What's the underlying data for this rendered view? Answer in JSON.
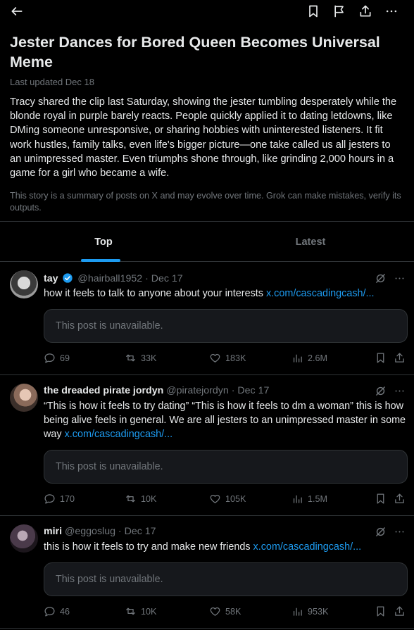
{
  "story": {
    "headline": "Jester Dances for Bored Queen Becomes Universal Meme",
    "updated": "Last updated Dec 18",
    "summary": "Tracy shared the clip last Saturday, showing the jester tumbling desperately while the blonde royal in purple barely reacts. People quickly applied it to dating letdowns, like DMing someone unresponsive, or sharing hobbies with uninterested listeners. It fit work hustles, family talks, even life's bigger picture—one take called us all jesters to an unimpressed master. Even triumphs shone through, like grinding 2,000 hours in a game for a girl who became a wife.",
    "disclaimer": "This story is a summary of posts on X and may evolve over time. Grok can make mistakes, verify its outputs."
  },
  "tabs": {
    "top": "Top",
    "latest": "Latest"
  },
  "unavailable_text": "This post is unavailable.",
  "posts": [
    {
      "name": "tay",
      "handle": "@hairball1952 · Dec 17",
      "text": "how it feels to talk to anyone about your interests ",
      "link": "x.com/cascadingcash/...",
      "replies": "69",
      "reposts": "33K",
      "likes": "183K",
      "views": "2.6M"
    },
    {
      "name": "the dreaded pirate jordyn",
      "handle": "@piratejordyn · Dec 17",
      "text": "“This is how it feels to try dating” “This is how it feels to dm a woman” this is how being alive feels in general. We are all jesters to an unimpressed master in some way ",
      "link": "x.com/cascadingcash/...",
      "replies": "170",
      "reposts": "10K",
      "likes": "105K",
      "views": "1.5M"
    },
    {
      "name": "miri",
      "handle": "@eggoslug · Dec 17",
      "text": "this is how it feels to try and make new friends ",
      "link": "x.com/cascadingcash/...",
      "replies": "46",
      "reposts": "10K",
      "likes": "58K",
      "views": "953K"
    }
  ],
  "colors": {
    "accent": "#1d9bf0",
    "muted": "#71767b",
    "text": "#e7e9ea",
    "background": "#000000"
  }
}
